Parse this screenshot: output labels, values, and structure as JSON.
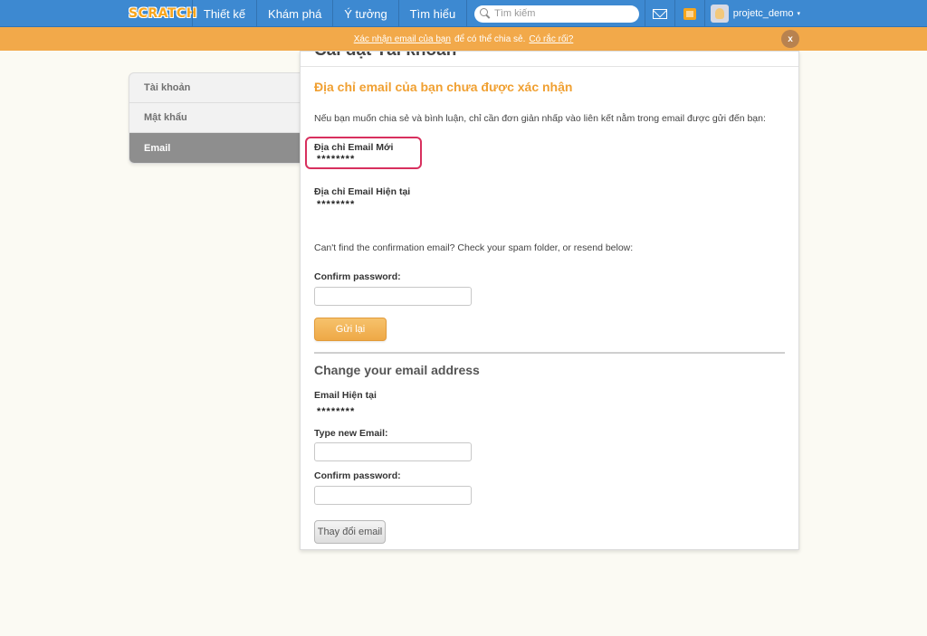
{
  "nav": {
    "logo": "SCRATCH",
    "items": [
      "Thiết kế",
      "Khám phá",
      "Ý tưởng",
      "Tìm hiểu"
    ],
    "search_placeholder": "Tìm kiếm",
    "username": "projetc_demo",
    "caret": "▾"
  },
  "banner": {
    "link_confirm": "Xác nhận email của bạn",
    "middle": "để có thể chia sẻ.",
    "link_trouble": "Có rắc rối?",
    "close": "x",
    "color": "#f2a94a"
  },
  "sidebar": {
    "items": [
      "Tài khoản",
      "Mật khẩu",
      "Email"
    ],
    "active": "Email"
  },
  "panel": {
    "title": "Cài đặt Tài khoản",
    "unverified_heading": "Địa chỉ email của bạn chưa được xác nhận",
    "info": "Nếu bạn muốn chia sẻ và bình luận, chỉ cần đơn giản nhấp vào liên kết nằm trong email được gửi đến bạn:",
    "new_email_label": "Địa chỉ Email Mới",
    "new_email_value": "********",
    "current_email_label": "Địa chỉ Email Hiện tại",
    "current_email_value": "********",
    "resend_hint": "Can't find the confirmation email? Check your spam folder, or resend below:",
    "confirm_password_label": "Confirm password:",
    "resend_button": "Gửi lại",
    "change_heading": "Change your email address",
    "email_current_label": "Email Hiện tại",
    "email_current_value": "********",
    "type_new_email_label": "Type new Email:",
    "confirm_password_label_2": "Confirm password:",
    "change_button": "Thay đổi email"
  },
  "colors": {
    "nav_blue": "#3d89d1",
    "accent_orange": "#f0a032",
    "highlight_red": "#d8305e"
  }
}
